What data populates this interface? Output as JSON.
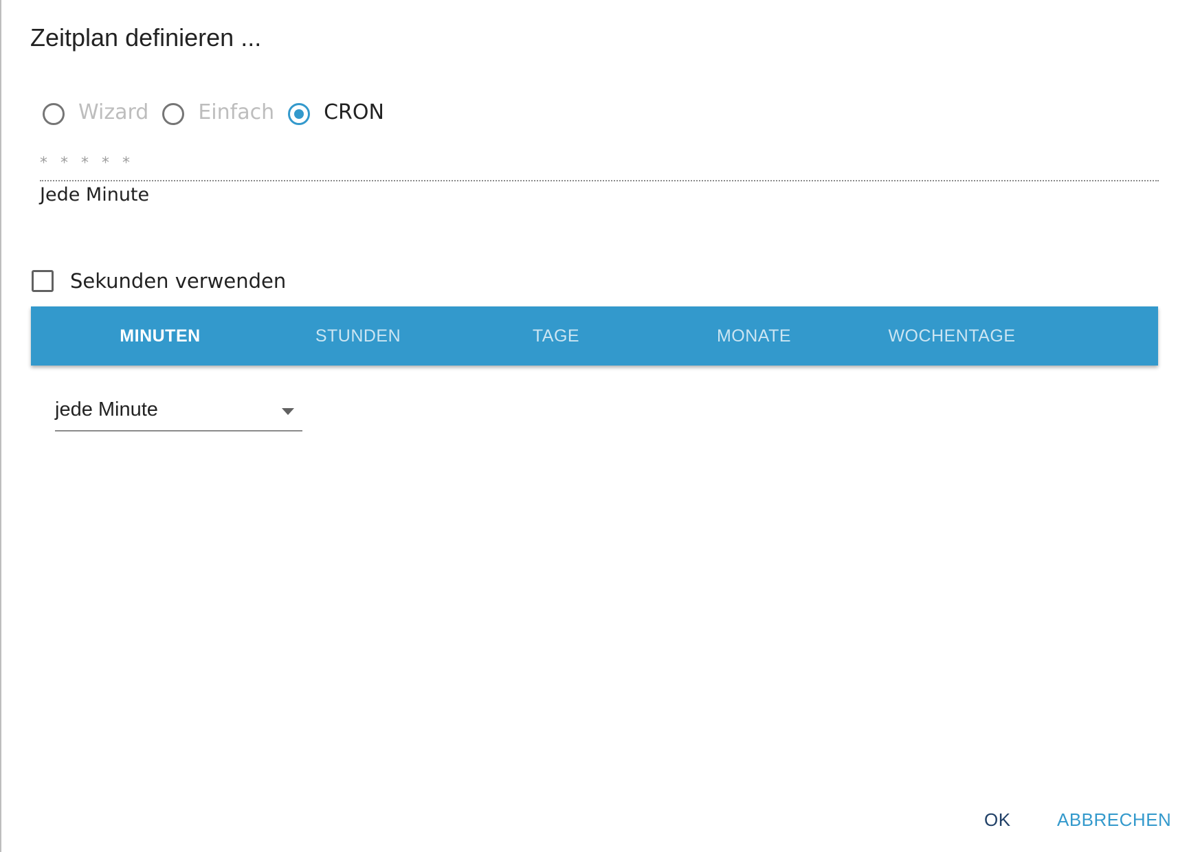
{
  "dialog": {
    "title": "Zeitplan definieren ..."
  },
  "mode": {
    "options": [
      {
        "label": "Wizard",
        "checked": false,
        "disabled": true
      },
      {
        "label": "Einfach",
        "checked": false,
        "disabled": true
      },
      {
        "label": "CRON",
        "checked": true,
        "disabled": false
      }
    ]
  },
  "cron": {
    "placeholder": "* * * * *",
    "value": "",
    "description": "Jede Minute"
  },
  "seconds": {
    "label": "Sekunden verwenden",
    "checked": false
  },
  "tabs": [
    {
      "label": "MINUTEN",
      "active": true
    },
    {
      "label": "STUNDEN",
      "active": false
    },
    {
      "label": "TAGE",
      "active": false
    },
    {
      "label": "MONATE",
      "active": false
    },
    {
      "label": "WOCHENTAGE",
      "active": false
    }
  ],
  "minutes_select": {
    "value": "jede Minute"
  },
  "actions": {
    "ok_label": "OK",
    "cancel_label": "ABBRECHEN"
  },
  "colors": {
    "accent": "#3399cc",
    "ok_text": "#1f3f66"
  }
}
